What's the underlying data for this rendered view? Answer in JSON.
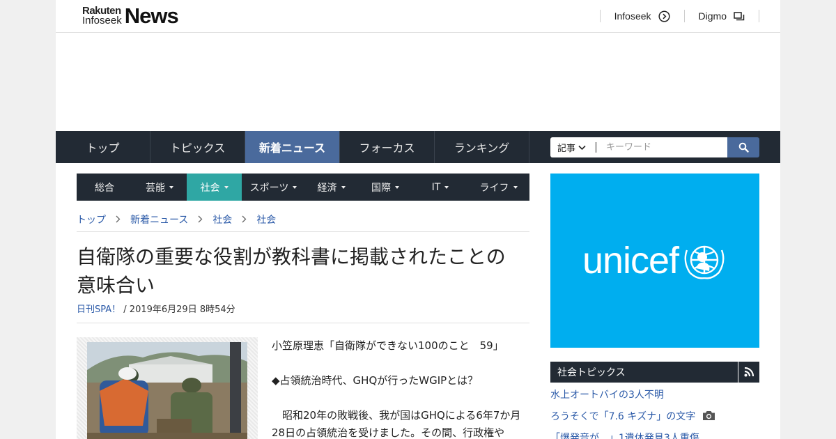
{
  "header": {
    "logo_line1": "Rakuten",
    "logo_line2": "Infoseek",
    "logo_big": "News",
    "links": [
      {
        "label": "Infoseek",
        "icon": "arrow-circle-icon"
      },
      {
        "label": "Digmo",
        "icon": "window-icon"
      }
    ]
  },
  "main_nav": {
    "tabs": [
      "トップ",
      "トピックス",
      "新着ニュース",
      "フォーカス",
      "ランキング"
    ],
    "active": "新着ニュース"
  },
  "search": {
    "scope": "記事",
    "placeholder": "キーワード",
    "button_icon": "search-icon"
  },
  "category_nav": {
    "items": [
      "総合",
      "芸能",
      "社会",
      "スポーツ",
      "経済",
      "国際",
      "IT",
      "ライフ"
    ],
    "active": "社会"
  },
  "breadcrumb": [
    "トップ",
    "新着ニュース",
    "社会",
    "社会"
  ],
  "article": {
    "title_line1": "自衛隊の重要な役割が教科書に掲載されたことの",
    "title_line2": "意味合い",
    "source": "日刊SPA！",
    "date": " / 2019年6月29日 8時54分",
    "paragraphs": [
      "小笠原理恵「自衛隊ができない100のこと　59」",
      "◆占領統治時代、GHQが行ったWGIPとは？",
      "　昭和20年の敗戦後、我が国はGHQによる6年7か月28日の占領統治を受けました。その間、行政権や"
    ]
  },
  "sidebar": {
    "ad_text": "unicef",
    "topics_title": "社会トピックス",
    "topics": [
      {
        "text": "水上オートバイの3人不明",
        "photo": false
      },
      {
        "text": "ろうそくで「7.6 キズナ」の文字",
        "photo": true
      },
      {
        "text": "「爆発音が…」1遺体発見3人重傷",
        "photo": false
      }
    ]
  },
  "colors": {
    "nav_bg": "#222a34",
    "nav_active": "#4a6a9c",
    "cat_active": "#2fa7a4",
    "link": "#2b5aa8",
    "unicef_blue": "#00aeef"
  }
}
